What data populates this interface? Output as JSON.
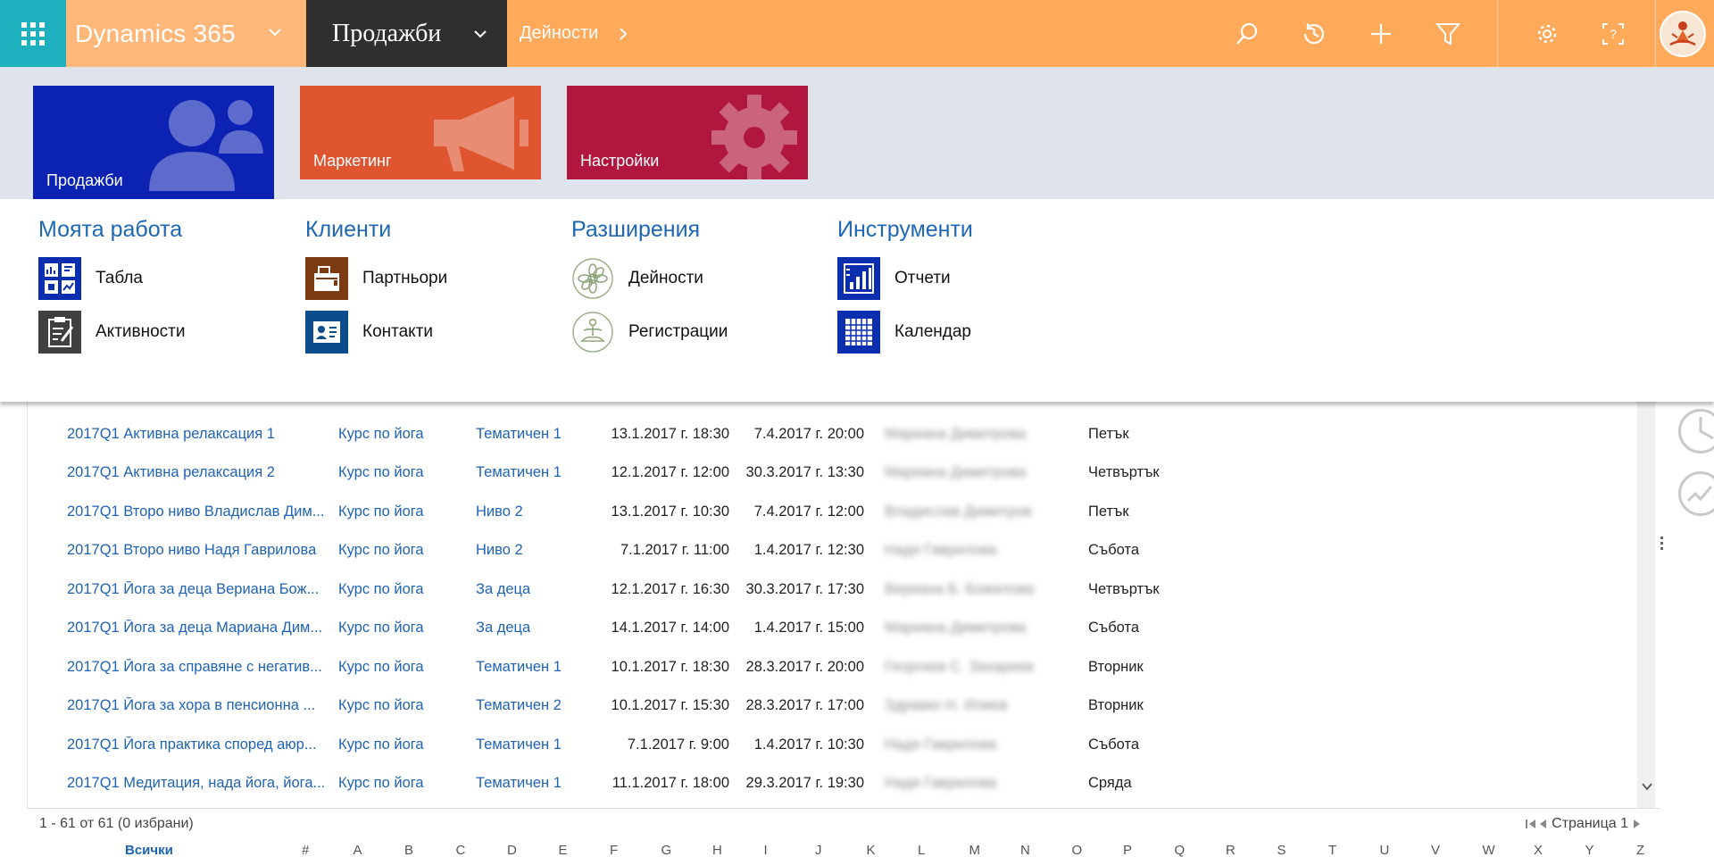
{
  "topbar": {
    "brand": "Dynamics 365",
    "app": "Продажби",
    "breadcrumb": "Дейности",
    "icons": [
      "search-icon",
      "history-icon",
      "add-icon",
      "filter-icon",
      "settings-icon",
      "help-icon"
    ]
  },
  "tiles": [
    {
      "label": "Продажби",
      "color": "#0B22B3",
      "icon": "users-icon"
    },
    {
      "label": "Маркетинг",
      "color": "#DE5530",
      "icon": "megaphone-icon"
    },
    {
      "label": "Настройки",
      "color": "#B0163E",
      "icon": "gear-icon"
    }
  ],
  "nav": {
    "groups": [
      {
        "title": "Моята работа",
        "items": [
          {
            "label": "Табла",
            "icon": "dashboard-icon"
          },
          {
            "label": "Активности",
            "icon": "activities-icon"
          }
        ]
      },
      {
        "title": "Клиенти",
        "items": [
          {
            "label": "Партньори",
            "icon": "accounts-icon"
          },
          {
            "label": "Контакти",
            "icon": "contacts-icon"
          }
        ]
      },
      {
        "title": "Разширения",
        "items": [
          {
            "label": "Дейности",
            "icon": "mandala-icon"
          },
          {
            "label": "Регистрации",
            "icon": "yoga-icon"
          }
        ]
      },
      {
        "title": "Инструменти",
        "items": [
          {
            "label": "Отчети",
            "icon": "reports-icon"
          },
          {
            "label": "Календар",
            "icon": "calendar-icon"
          }
        ]
      }
    ]
  },
  "grid": {
    "rows": [
      {
        "name": "2017Q1 Активна релаксация 1",
        "type": "Курс по йога",
        "category": "Тематичен 1",
        "start": "13.1.2017 г. 18:30",
        "end": "7.4.2017 г. 20:00",
        "teacher": "Мариана Димитрова",
        "day": "Петък"
      },
      {
        "name": "2017Q1 Активна релаксация 2",
        "type": "Курс по йога",
        "category": "Тематичен 1",
        "start": "12.1.2017 г. 12:00",
        "end": "30.3.2017 г. 13:30",
        "teacher": "Мариана Димитрова",
        "day": "Четвъртък"
      },
      {
        "name": "2017Q1 Второ ниво Владислав Дим...",
        "type": "Курс по йога",
        "category": "Ниво 2",
        "start": "13.1.2017 г. 10:30",
        "end": "7.4.2017 г. 12:00",
        "teacher": "Владислав Димитров",
        "day": "Петък"
      },
      {
        "name": "2017Q1 Второ ниво Надя Гаврилова",
        "type": "Курс по йога",
        "category": "Ниво 2",
        "start": "7.1.2017 г. 11:00",
        "end": "1.4.2017 г. 12:30",
        "teacher": "Надя Гаврилова",
        "day": "Събота"
      },
      {
        "name": "2017Q1 Йога за деца Вериана Бож...",
        "type": "Курс по йога",
        "category": "За деца",
        "start": "12.1.2017 г. 16:30",
        "end": "30.3.2017 г. 17:30",
        "teacher": "Вериана Б. Божилова",
        "day": "Четвъртък"
      },
      {
        "name": "2017Q1 Йога за деца Мариана Дим...",
        "type": "Курс по йога",
        "category": "За деца",
        "start": "14.1.2017 г. 14:00",
        "end": "1.4.2017 г. 15:00",
        "teacher": "Мариана Димитрова",
        "day": "Събота"
      },
      {
        "name": "2017Q1 Йога за справяне с негатив...",
        "type": "Курс по йога",
        "category": "Тематичен 1",
        "start": "10.1.2017 г. 18:30",
        "end": "28.3.2017 г. 20:00",
        "teacher": "Георгиев С. Захариев",
        "day": "Вторник"
      },
      {
        "name": "2017Q1 Йога за хора в пенсионна ...",
        "type": "Курс по йога",
        "category": "Тематичен 2",
        "start": "10.1.2017 г. 15:30",
        "end": "28.3.2017 г. 17:00",
        "teacher": "Здравко Н. Илиев",
        "day": "Вторник"
      },
      {
        "name": "2017Q1 Йога практика според аюр...",
        "type": "Курс по йога",
        "category": "Тематичен 1",
        "start": "7.1.2017 г. 9:00",
        "end": "1.4.2017 г. 10:30",
        "teacher": "Надя Гаврилова",
        "day": "Събота"
      },
      {
        "name": "2017Q1 Медитация, нада йога, йога...",
        "type": "Курс по йога",
        "category": "Тематичен 1",
        "start": "11.1.2017 г. 18:00",
        "end": "29.3.2017 г. 19:30",
        "teacher": "Надя Гаврилова",
        "day": "Сряда"
      }
    ]
  },
  "footer": {
    "count": "1 - 61  от 61 (0 избрани)",
    "page_label": "Страница 1"
  },
  "alphabet": {
    "all": "Всички",
    "letters": [
      "#",
      "A",
      "B",
      "C",
      "D",
      "E",
      "F",
      "G",
      "H",
      "I",
      "J",
      "K",
      "L",
      "M",
      "N",
      "O",
      "P",
      "Q",
      "R",
      "S",
      "T",
      "U",
      "V",
      "W",
      "X",
      "Y",
      "Z"
    ]
  },
  "colors": {
    "topbar": "#FFA95A",
    "waffle": "#1EB0BF",
    "app_block": "#2F2F2F",
    "link": "#1F63B5",
    "nav_heading": "#1E67B5"
  }
}
